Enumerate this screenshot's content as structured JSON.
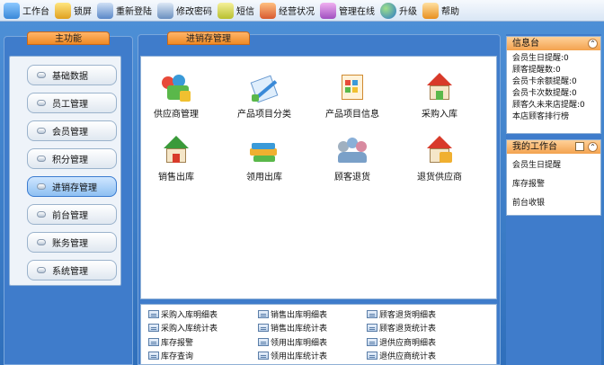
{
  "toolbar": {
    "items": [
      {
        "label": "工作台",
        "icon": "desk-icon",
        "color": "#4aa0e8"
      },
      {
        "label": "锁屏",
        "icon": "lock-icon",
        "color": "#e8b830"
      },
      {
        "label": "重新登陆",
        "icon": "relogin-icon",
        "color": "#6a9ad8"
      },
      {
        "label": "修改密码",
        "icon": "password-icon",
        "color": "#5a8ac0"
      },
      {
        "label": "短信",
        "icon": "sms-icon",
        "color": "#d8d040"
      },
      {
        "label": "经营状况",
        "icon": "business-status-icon",
        "color": "#d85a30"
      },
      {
        "label": "管理在线",
        "icon": "manage-online-icon",
        "color": "#c06ad8"
      },
      {
        "label": "升级",
        "icon": "upgrade-globe-icon",
        "color": "#3a8ad8"
      },
      {
        "label": "帮助",
        "icon": "help-icon",
        "color": "#f0a030"
      }
    ]
  },
  "left": {
    "tab": "主功能",
    "menu": [
      {
        "label": "基础数据",
        "active": false
      },
      {
        "label": "员工管理",
        "active": false
      },
      {
        "label": "会员管理",
        "active": false
      },
      {
        "label": "积分管理",
        "active": false
      },
      {
        "label": "进销存管理",
        "active": true
      },
      {
        "label": "前台管理",
        "active": false
      },
      {
        "label": "账务管理",
        "active": false
      },
      {
        "label": "系统管理",
        "active": false
      }
    ]
  },
  "center": {
    "tab": "进销存管理",
    "icons": [
      {
        "label": "供应商管理",
        "icon": "supplier-icon"
      },
      {
        "label": "产品项目分类",
        "icon": "product-category-icon"
      },
      {
        "label": "产品项目信息",
        "icon": "product-info-icon"
      },
      {
        "label": "采购入库",
        "icon": "purchase-inbound-icon"
      },
      {
        "label": "销售出库",
        "icon": "sales-outbound-icon"
      },
      {
        "label": "领用出库",
        "icon": "requisition-outbound-icon"
      },
      {
        "label": "顾客退货",
        "icon": "customer-return-icon"
      },
      {
        "label": "退货供应商",
        "icon": "return-supplier-icon"
      }
    ],
    "reports": [
      [
        "采购入库明细表",
        "销售出库明细表",
        "顾客退货明细表"
      ],
      [
        "采购入库统计表",
        "销售出库统计表",
        "顾客退货统计表"
      ],
      [
        "库存报警",
        "领用出库明细表",
        "退供应商明细表"
      ],
      [
        "库存查询",
        "领用出库统计表",
        "退供应商统计表"
      ]
    ]
  },
  "right": {
    "info": {
      "title": "信息台",
      "toggle": "⌃",
      "rows": [
        {
          "label": "会员生日提醒:",
          "value": "0"
        },
        {
          "label": "顾客提醒数:",
          "value": "0"
        },
        {
          "label": "会员卡余额提醒:",
          "value": "0"
        },
        {
          "label": "会员卡次数提醒:",
          "value": "0"
        },
        {
          "label": "顾客久未来店提醒:",
          "value": "0"
        },
        {
          "label": "本店顾客排行榜",
          "value": ""
        }
      ]
    },
    "workbench": {
      "title": "我的工作台",
      "toggle": "⌃",
      "rows": [
        "会员生日提醒",
        "库存报警",
        "前台收银"
      ]
    }
  },
  "colors": {
    "accent": "#f08a24",
    "frame": "#3f7ccb",
    "active_menu": "#8ec0f2"
  }
}
